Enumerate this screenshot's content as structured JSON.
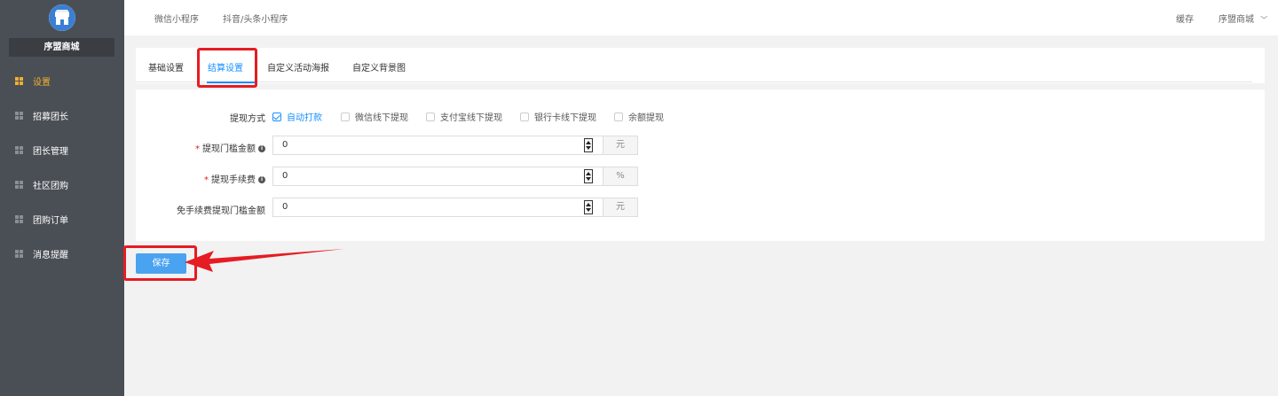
{
  "sidebar": {
    "brand": "序盟商城",
    "items": [
      {
        "label": "设置",
        "active": true
      },
      {
        "label": "招募团长",
        "active": false
      },
      {
        "label": "团长管理",
        "active": false
      },
      {
        "label": "社区团购",
        "active": false
      },
      {
        "label": "团购订单",
        "active": false
      },
      {
        "label": "消息提醒",
        "active": false
      }
    ]
  },
  "topbar": {
    "links": [
      "微信小程序",
      "抖音/头条小程序"
    ],
    "cache": "缓存",
    "user": "序盟商城",
    "user_chevron": "﹀"
  },
  "tabs": [
    {
      "label": "基础设置",
      "active": false
    },
    {
      "label": "结算设置",
      "active": true
    },
    {
      "label": "自定义活动海报",
      "active": false
    },
    {
      "label": "自定义背景图",
      "active": false
    }
  ],
  "form": {
    "withdraw_method": {
      "label": "提现方式",
      "options": [
        {
          "label": "自动打款",
          "checked": true
        },
        {
          "label": "微信线下提现",
          "checked": false
        },
        {
          "label": "支付宝线下提现",
          "checked": false
        },
        {
          "label": "银行卡线下提现",
          "checked": false
        },
        {
          "label": "余额提现",
          "checked": false
        }
      ]
    },
    "threshold": {
      "label": "提现门槛金额",
      "required": "*",
      "value": "0",
      "unit": "元"
    },
    "fee": {
      "label": "提现手续费",
      "required": "*",
      "value": "0",
      "unit": "%"
    },
    "free_threshold": {
      "label": "免手续费提现门槛金额",
      "value": "0",
      "unit": "元"
    }
  },
  "save_button": "保存",
  "colors": {
    "sidebar_bg": "#4a4f55",
    "accent": "#1890ff",
    "active_nav": "#f0b030",
    "annotation": "#e51c23"
  }
}
